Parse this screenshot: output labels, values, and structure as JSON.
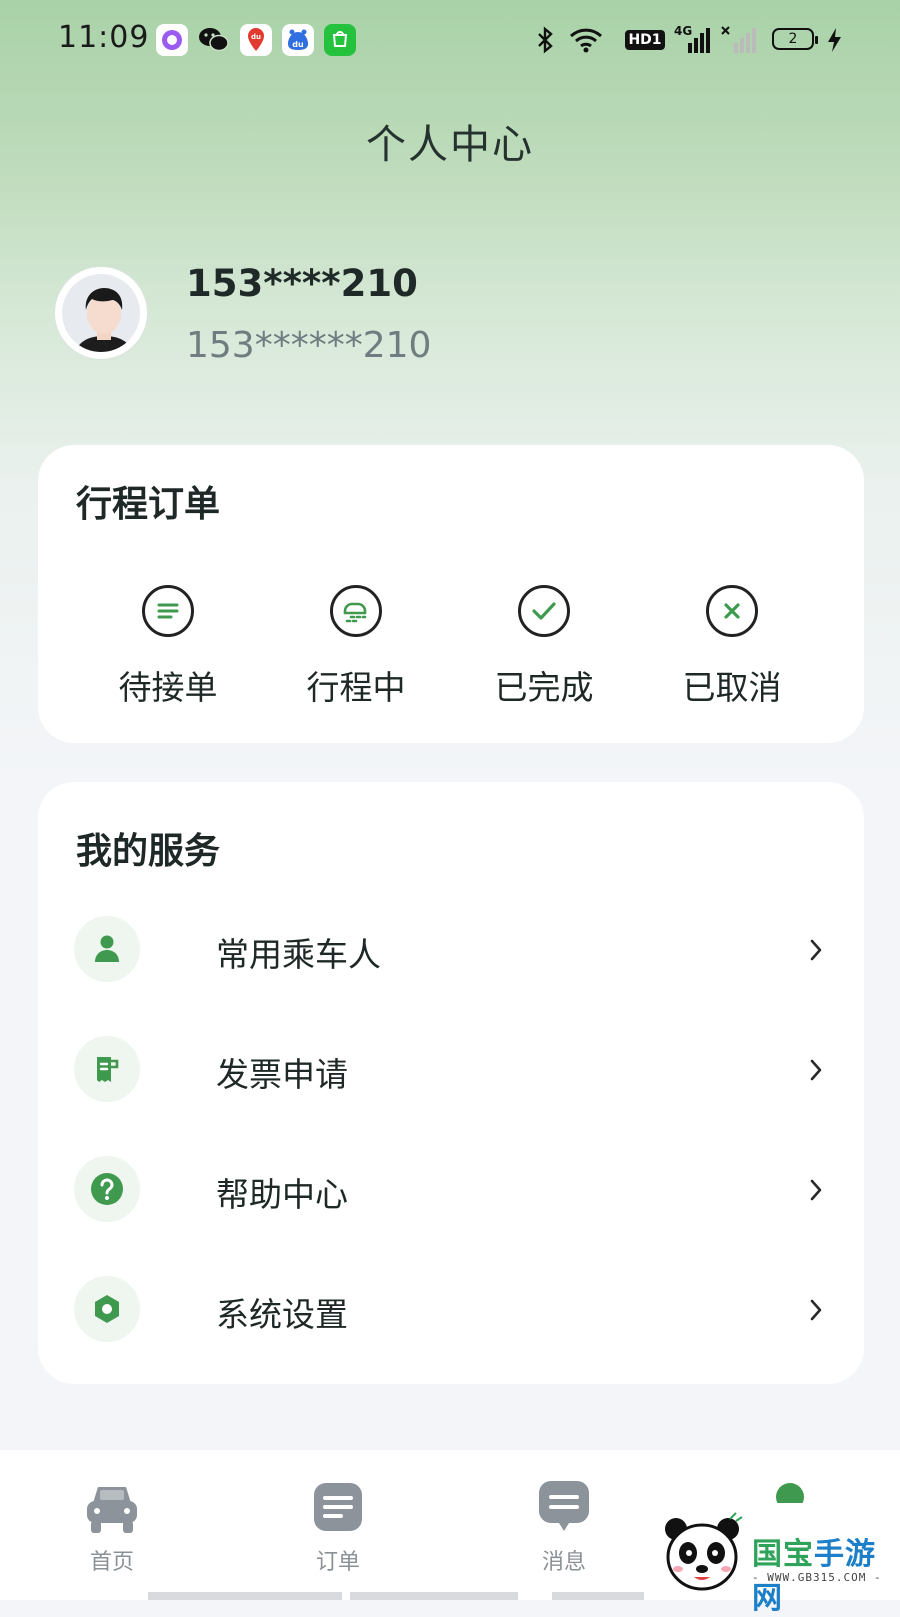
{
  "status_bar": {
    "time": "11:09",
    "apps": [
      {
        "icon": "app-ring-icon"
      },
      {
        "icon": "wechat-icon"
      },
      {
        "icon": "baidu-map-icon",
        "text": "du"
      },
      {
        "icon": "baidu-icon",
        "text": "du"
      },
      {
        "icon": "green-app-icon"
      }
    ],
    "system": [
      {
        "icon": "bluetooth-icon"
      },
      {
        "icon": "wifi-icon"
      },
      {
        "icon": "hd-icon",
        "text": "HD1"
      },
      {
        "icon": "signal-4g-icon",
        "text": "4G"
      },
      {
        "icon": "signal-off-icon"
      }
    ],
    "battery_level": "2"
  },
  "header": {
    "title": "个人中心"
  },
  "user": {
    "name": "153****210",
    "phone": "153******210"
  },
  "orders": {
    "title": "行程订单",
    "items": [
      {
        "label": "待接单",
        "icon": "list-circle-icon"
      },
      {
        "label": "行程中",
        "icon": "car-wind-circle-icon"
      },
      {
        "label": "已完成",
        "icon": "check-circle-icon"
      },
      {
        "label": "已取消",
        "icon": "x-circle-icon"
      }
    ]
  },
  "services": {
    "title": "我的服务",
    "items": [
      {
        "label": "常用乘车人",
        "icon": "person-icon"
      },
      {
        "label": "发票申请",
        "icon": "invoice-icon"
      },
      {
        "label": "帮助中心",
        "icon": "help-icon"
      },
      {
        "label": "系统设置",
        "icon": "settings-icon"
      }
    ]
  },
  "bottom_nav": {
    "items": [
      {
        "label": "首页",
        "icon": "car-icon"
      },
      {
        "label": "订单",
        "icon": "order-doc-icon"
      },
      {
        "label": "消息",
        "icon": "message-icon"
      },
      {
        "label": "",
        "icon": "profile-icon"
      }
    ]
  },
  "watermark": {
    "brand_a": "国宝",
    "brand_b": "手游网",
    "url": "- WWW.GB315.COM -"
  },
  "colors": {
    "accent": "#3f9a4f",
    "accent_light": "#eef6ef",
    "text": "#1e2826",
    "muted": "#8a9196"
  }
}
